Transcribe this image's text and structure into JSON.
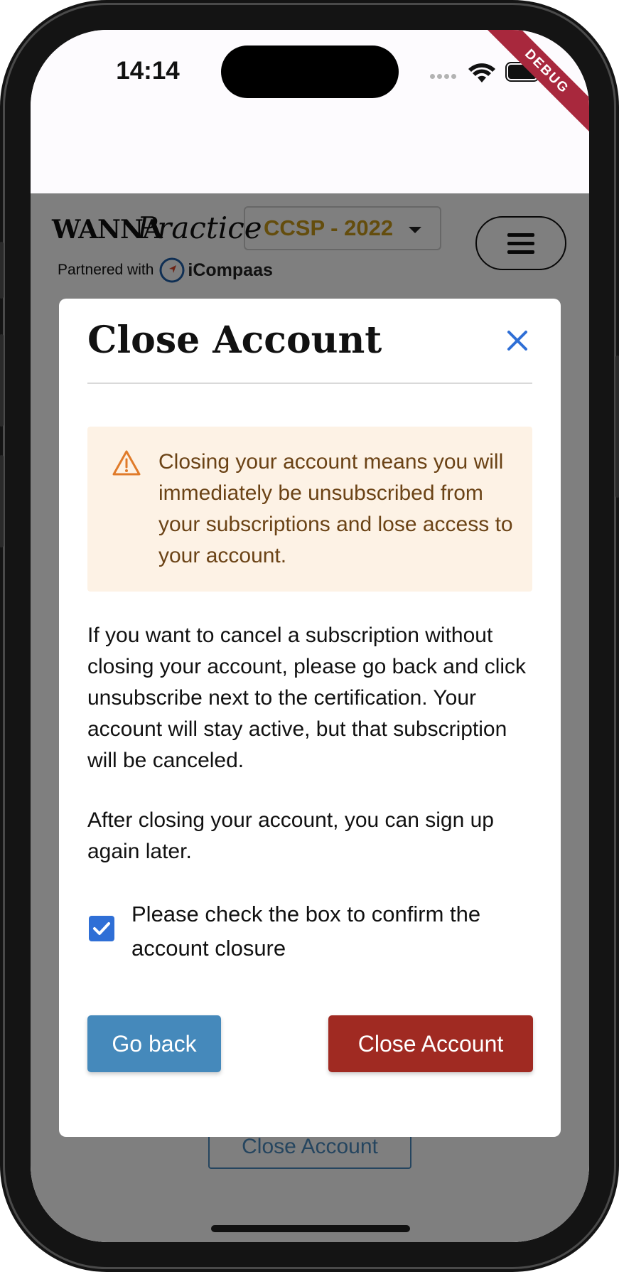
{
  "status_bar": {
    "time": "14:14",
    "debug_label": "DEBUG"
  },
  "header": {
    "logo_wanna": "WANNA",
    "logo_practice": "Practice",
    "partner_text": "Partnered with",
    "partner_brand": "iCompaas",
    "cert_selected": "CCSP - 2022",
    "menu_icon": "hamburger-menu-icon"
  },
  "page": {
    "background_button_label": "Close Account"
  },
  "modal": {
    "title": "Close Account",
    "close_icon": "close-icon",
    "warning": {
      "icon": "warning-triangle-icon",
      "text": "Closing your account means you will immediately be unsubscribed from your subscriptions and lose access to your account."
    },
    "paragraph1": "If you want to cancel a subscription without closing your account, please go back and click unsubscribe next to the certification. Your account will stay active, but that subscription will be canceled.",
    "paragraph2": "After closing your account, you can sign up again later.",
    "confirm_checkbox_checked": true,
    "confirm_label": "Please check the box to confirm the account closure",
    "go_back_label": "Go back",
    "close_account_label": "Close Account"
  },
  "colors": {
    "accent_blue": "#4589bb",
    "danger_red": "#a02a22",
    "checkbox_blue": "#2f6fd6",
    "warning_bg": "#fdf2e5",
    "warning_text": "#6b4316",
    "cert_gold": "#c99a1b",
    "debug_ribbon": "#a8283d"
  }
}
